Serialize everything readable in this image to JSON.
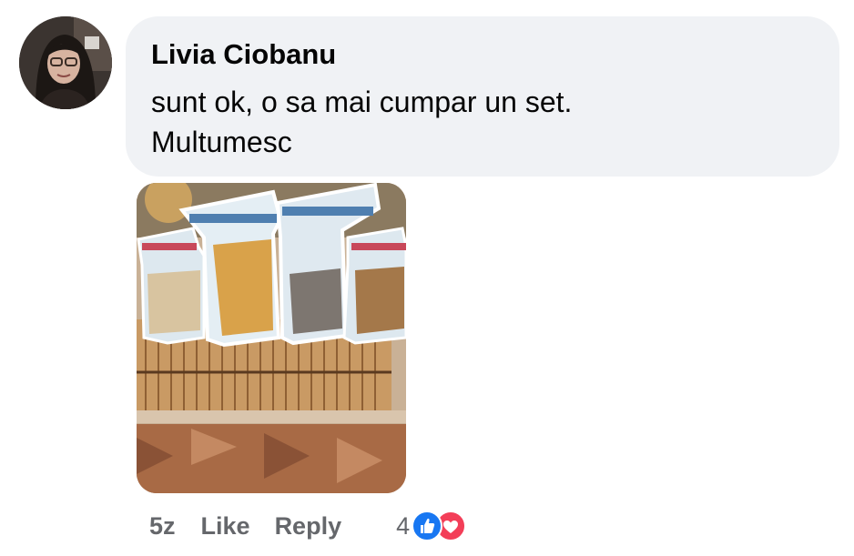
{
  "comment": {
    "author": "Livia Ciobanu",
    "text": "sunt ok, o sa mai cumpar un set. Multumesc",
    "attachment_icon": "photo-image"
  },
  "actions": {
    "timestamp": "5z",
    "like_label": "Like",
    "reply_label": "Reply",
    "reaction_count": "4",
    "reaction_icons": [
      "like-icon",
      "love-icon"
    ]
  },
  "colors": {
    "bubble_bg": "#f0f2f5",
    "text": "#050505",
    "secondary_text": "#65676b",
    "like_blue": "#1877f2",
    "love_red": "#f33e58"
  }
}
